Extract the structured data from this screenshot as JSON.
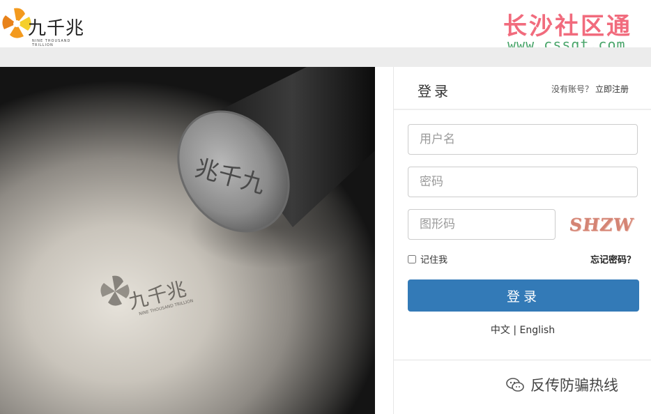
{
  "header": {
    "logo_text": "九千兆",
    "logo_subtitle": "NINE THOUSAND TRILLION",
    "watermark_title": "长沙社区通",
    "watermark_url": "www.cssqt.com"
  },
  "login": {
    "title": "登录",
    "no_account": "没有账号？",
    "register": "立即注册",
    "username_placeholder": "用户名",
    "password_placeholder": "密码",
    "captcha_placeholder": "图形码",
    "captcha_image_text": "SHZW",
    "remember_label": "记住我",
    "forgot_password": "忘记密码？",
    "submit": "登录",
    "lang_chinese": "中文",
    "lang_separator": "|",
    "lang_english": "English"
  },
  "footer": {
    "wechat_label": "反传防骗热线"
  },
  "hero": {
    "stamp_text": "兆千九",
    "embossed_text": "九千兆",
    "embossed_subtitle": "NINE THOUSAND TRILLION"
  },
  "colors": {
    "primary_button": "#337ab7",
    "watermark_title": "#f16b7d",
    "watermark_url": "#49a56a",
    "captcha": "#d48474",
    "logo_orange": "#f39a1e",
    "logo_yellow": "#f5cf2a"
  }
}
